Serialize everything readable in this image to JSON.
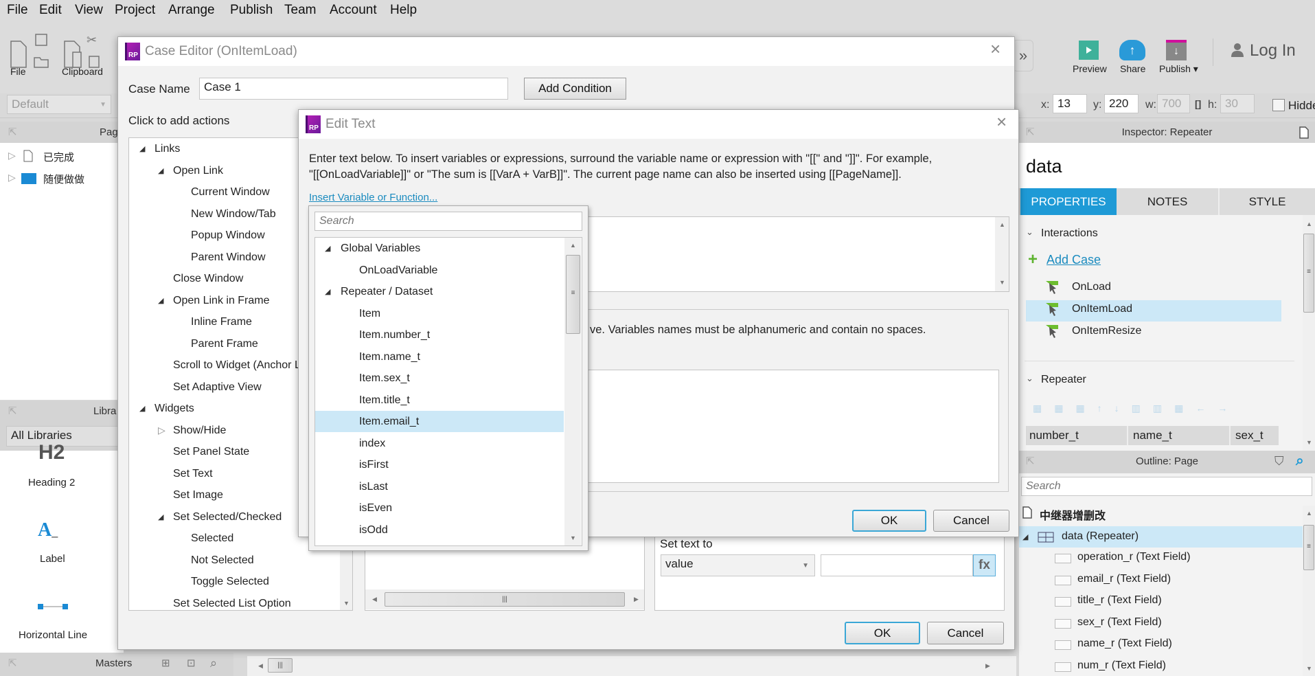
{
  "menu": [
    "File",
    "Edit",
    "View",
    "Project",
    "Arrange",
    "Publish",
    "Team",
    "Account",
    "Help"
  ],
  "toolbar": {
    "file": "File",
    "clipboard": "Clipboard",
    "preview": "Preview",
    "share": "Share",
    "publish": "Publish ▾",
    "login": "Log In",
    "style_select": "Default",
    "x_label": "x:",
    "x": "13",
    "y_label": "y:",
    "y": "220",
    "w_label": "w:",
    "w": "700",
    "h_label": "h:",
    "h": "30",
    "hidden": "Hidde"
  },
  "pages": {
    "header": "Pag",
    "items": [
      "已完成",
      "随便做做"
    ]
  },
  "libraries": {
    "header": "Libra",
    "select": "All Libraries",
    "items": [
      "Heading 2",
      "Label",
      "Horizontal Line"
    ]
  },
  "masters": {
    "header": "Masters"
  },
  "case_editor": {
    "title": "Case Editor (OnItemLoad)",
    "case_name_label": "Case Name",
    "case_name": "Case 1",
    "add_condition": "Add Condition",
    "click_to_add": "Click to add actions",
    "actions": [
      {
        "label": "Links",
        "level": 0,
        "exp": "open"
      },
      {
        "label": "Open Link",
        "level": 1,
        "exp": "open"
      },
      {
        "label": "Current Window",
        "level": 2
      },
      {
        "label": "New Window/Tab",
        "level": 2
      },
      {
        "label": "Popup Window",
        "level": 2
      },
      {
        "label": "Parent Window",
        "level": 2
      },
      {
        "label": "Close Window",
        "level": 1
      },
      {
        "label": "Open Link in Frame",
        "level": 1,
        "exp": "open"
      },
      {
        "label": "Inline Frame",
        "level": 2
      },
      {
        "label": "Parent Frame",
        "level": 2
      },
      {
        "label": "Scroll to Widget (Anchor Li",
        "level": 1
      },
      {
        "label": "Set Adaptive View",
        "level": 1
      },
      {
        "label": "Widgets",
        "level": 0,
        "exp": "open"
      },
      {
        "label": "Show/Hide",
        "level": 1,
        "exp": "closed"
      },
      {
        "label": "Set Panel State",
        "level": 1
      },
      {
        "label": "Set Text",
        "level": 1
      },
      {
        "label": "Set Image",
        "level": 1
      },
      {
        "label": "Set Selected/Checked",
        "level": 1,
        "exp": "open"
      },
      {
        "label": "Selected",
        "level": 2
      },
      {
        "label": "Not Selected",
        "level": 2
      },
      {
        "label": "Toggle Selected",
        "level": 2
      },
      {
        "label": "Set Selected List Option",
        "level": 1
      }
    ],
    "set_text_to": "Set text to",
    "value_select": "value",
    "fx": "fx",
    "ok": "OK",
    "cancel": "Cancel"
  },
  "edit_text": {
    "title": "Edit Text",
    "instructions_1": "Enter text below. To insert variables or expressions, surround the variable name or expression with \"[[\" and \"]]\". For example,",
    "instructions_2": "\"[[OnLoadVariable]]\" or \"The sum is [[VarA + VarB]]\". The current page name can also be inserted using [[PageName]].",
    "insert_link": "Insert Variable or Function...",
    "local_vars_text": "ve. Variables names must be alphanumeric and contain no spaces.",
    "ok": "OK",
    "cancel": "Cancel"
  },
  "variable_popup": {
    "search_placeholder": "Search",
    "items": [
      {
        "label": "Global Variables",
        "level": 0,
        "exp": "open"
      },
      {
        "label": "OnLoadVariable",
        "level": 1
      },
      {
        "label": "Repeater / Dataset",
        "level": 0,
        "exp": "open"
      },
      {
        "label": "Item",
        "level": 1
      },
      {
        "label": "Item.number_t",
        "level": 1
      },
      {
        "label": "Item.name_t",
        "level": 1
      },
      {
        "label": "Item.sex_t",
        "level": 1
      },
      {
        "label": "Item.title_t",
        "level": 1
      },
      {
        "label": "Item.email_t",
        "level": 1,
        "selected": true
      },
      {
        "label": "index",
        "level": 1
      },
      {
        "label": "isFirst",
        "level": 1
      },
      {
        "label": "isLast",
        "level": 1
      },
      {
        "label": "isEven",
        "level": 1
      },
      {
        "label": "isOdd",
        "level": 1
      }
    ]
  },
  "inspector": {
    "header": "Inspector: Repeater",
    "name": "data",
    "tabs": [
      "PROPERTIES",
      "NOTES",
      "STYLE"
    ],
    "active_tab": "PROPERTIES",
    "interactions": "Interactions",
    "add_case": "Add Case",
    "events": [
      "OnLoad",
      "OnItemLoad",
      "OnItemResize"
    ],
    "selected_event": "OnItemLoad",
    "repeater": "Repeater",
    "columns": [
      "number_t",
      "name_t",
      "sex_t"
    ]
  },
  "outline": {
    "header": "Outline: Page",
    "search_placeholder": "Search",
    "page": "中继器增删改",
    "repeater": "data (Repeater)",
    "children": [
      "operation_r (Text Field)",
      "email_r (Text Field)",
      "title_r (Text Field)",
      "sex_r (Text Field)",
      "name_r (Text Field)",
      "num_r (Text Field)"
    ]
  },
  "colors": {
    "accent": "#1e9ad6",
    "selected_row": "#cce8f7",
    "link": "#1a8bbf",
    "brand": "#9b1fb0"
  }
}
